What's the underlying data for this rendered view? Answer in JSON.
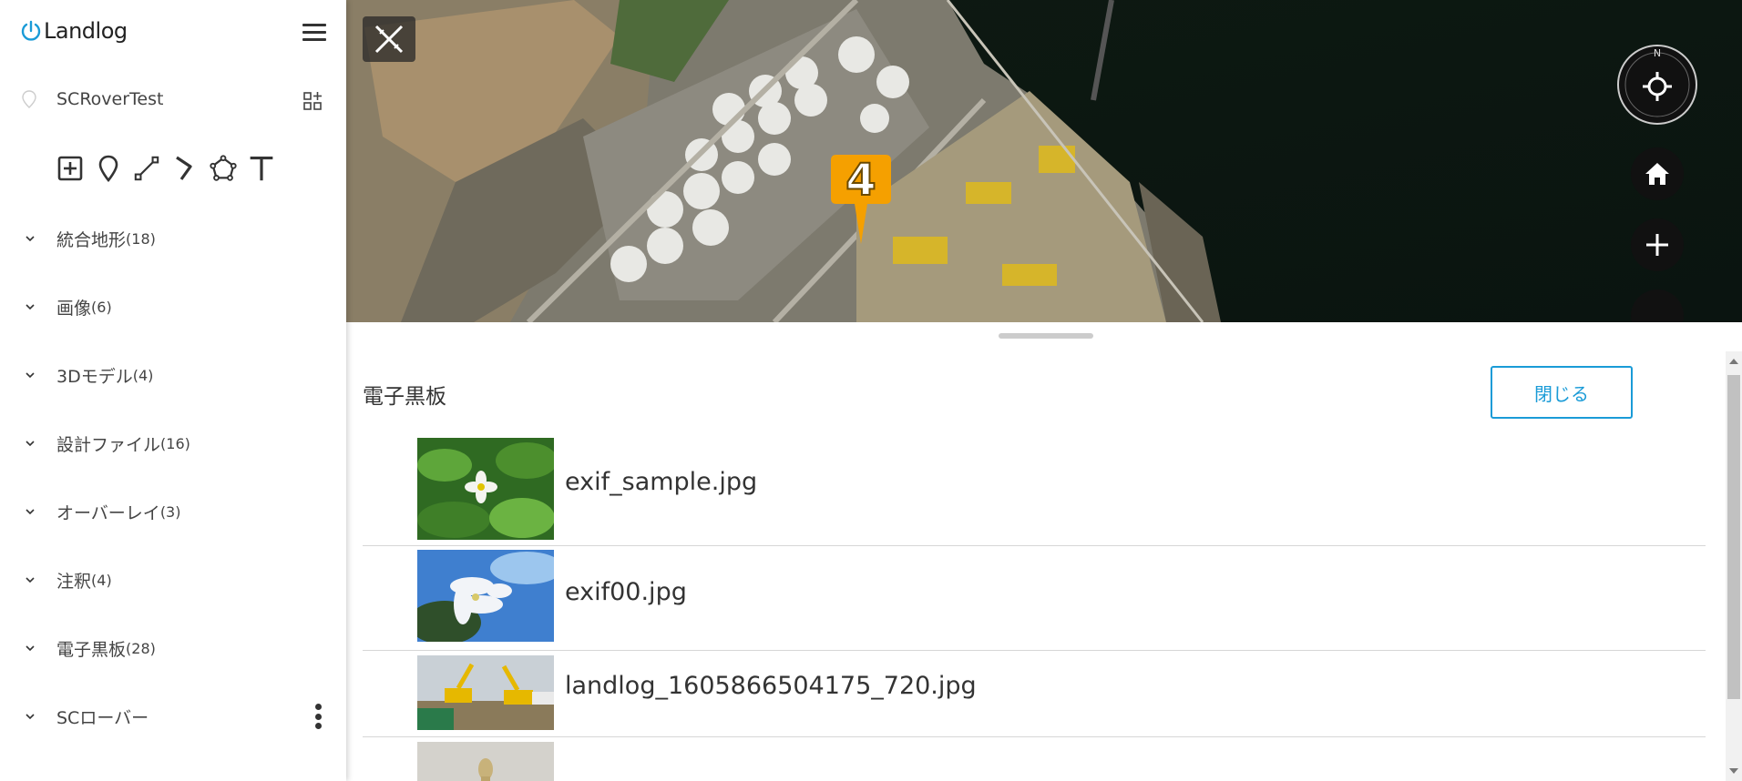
{
  "app": {
    "logo_text": "Landlog"
  },
  "project": {
    "name": "SCRoverTest"
  },
  "layers": [
    {
      "label": "統合地形",
      "count": "(18)"
    },
    {
      "label": "画像",
      "count": "(6)"
    },
    {
      "label": "3Dモデル",
      "count": "(4)"
    },
    {
      "label": "設計ファイル",
      "count": "(16)"
    },
    {
      "label": "オーバーレイ",
      "count": "(3)"
    },
    {
      "label": "注釈",
      "count": "(4)"
    },
    {
      "label": "電子黒板",
      "count": "(28)"
    },
    {
      "label": "SCローバー",
      "count": ""
    }
  ],
  "map": {
    "marker_count": "4",
    "compass_label": "N"
  },
  "panel": {
    "title": "電子黒板",
    "close_label": "閉じる",
    "photos": [
      {
        "filename": "exif_sample.jpg"
      },
      {
        "filename": "exif00.jpg"
      },
      {
        "filename": "landlog_1605866504175_720.jpg"
      },
      {
        "filename": ""
      }
    ]
  },
  "colors": {
    "accent": "#1a9bd7",
    "marker": "#f5a000"
  }
}
